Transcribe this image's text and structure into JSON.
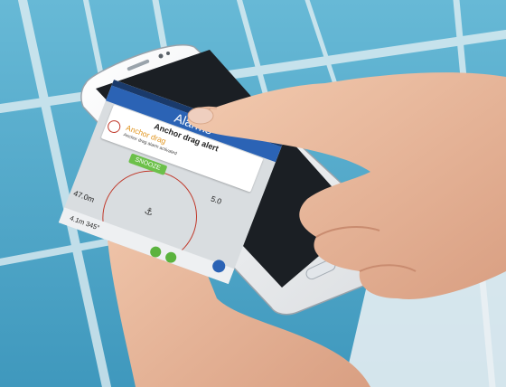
{
  "app": {
    "title": "Alarms"
  },
  "popup": {
    "title": "Anchor drag alert",
    "alarm_name": "Anchor drag",
    "alarm_desc": "Anchor drag alarm activated"
  },
  "map": {
    "action_label": "SNOOZE",
    "distance_top": "5.0",
    "distance_left": "47.0m"
  },
  "footer": {
    "bearing": "4.1m 345°"
  },
  "colors": {
    "sea": "#4fa9c9",
    "title_bar": "#2b63b5",
    "alarm_ring": "#c0392b",
    "alarm_text": "#e0941c",
    "action_green": "#6cc04a"
  }
}
